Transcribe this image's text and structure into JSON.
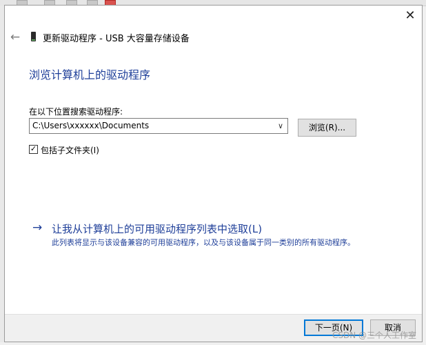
{
  "window": {
    "title": "更新驱动程序 - USB 大容量存储设备",
    "close_glyph": "✕",
    "back_glyph": "←"
  },
  "main": {
    "heading": "浏览计算机上的驱动程序",
    "search_label": "在以下位置搜索驱动程序:",
    "path_value": "C:\\Users\\xxxxxx\\Documents",
    "dropdown_glyph": "∨",
    "browse_button": "浏览(R)...",
    "include_subfolders_label": "包括子文件夹(I)",
    "include_subfolders_checked": true,
    "check_glyph": "✓"
  },
  "link": {
    "arrow_glyph": "→",
    "title": "让我从计算机上的可用驱动程序列表中选取(L)",
    "description": "此列表将显示与该设备兼容的可用驱动程序，以及与该设备属于同一类别的所有驱动程序。"
  },
  "footer": {
    "next_button": "下一页(N)",
    "cancel_button": "取消"
  },
  "watermark": "CSDN @三个人工作室",
  "colors": {
    "link_blue": "#1f3f99",
    "focus_border": "#0078d7"
  }
}
